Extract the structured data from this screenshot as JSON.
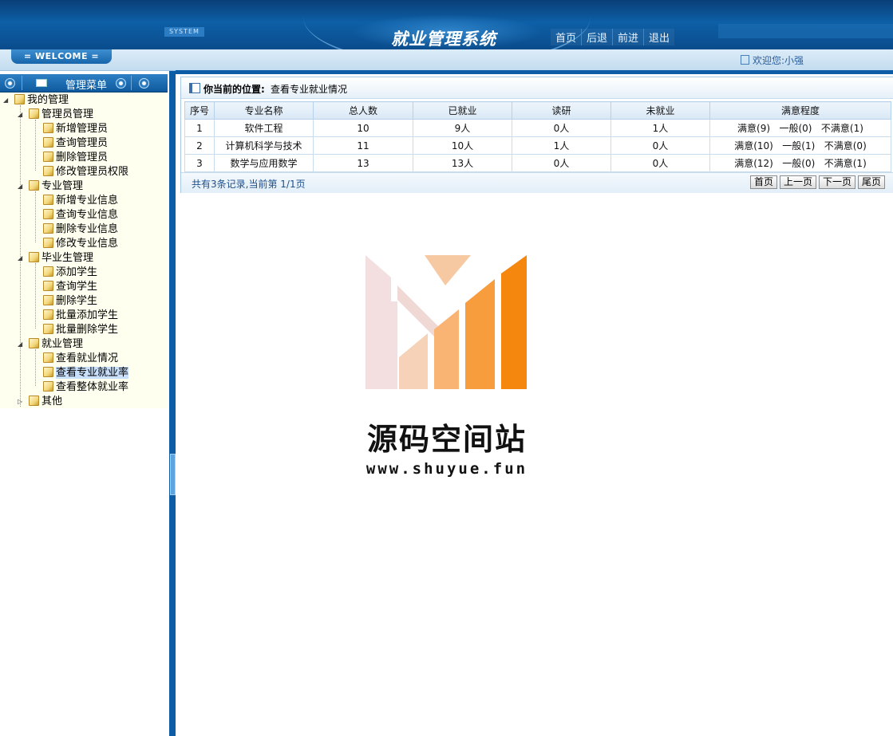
{
  "header": {
    "system_tag": "SYSTEM",
    "title": "就业管理系统",
    "nav": [
      "首页",
      "后退",
      "前进",
      "退出"
    ]
  },
  "welcome": {
    "badge": "= WELCOME =",
    "user_text": "欢迎您:小强"
  },
  "sidebar": {
    "menu_title": "管理菜单",
    "root": "我的管理",
    "groups": [
      {
        "label": "管理员管理",
        "items": [
          "新增管理员",
          "查询管理员",
          "删除管理员",
          "修改管理员权限"
        ]
      },
      {
        "label": "专业管理",
        "items": [
          "新增专业信息",
          "查询专业信息",
          "删除专业信息",
          "修改专业信息"
        ]
      },
      {
        "label": "毕业生管理",
        "items": [
          "添加学生",
          "查询学生",
          "删除学生",
          "批量添加学生",
          "批量删除学生"
        ]
      },
      {
        "label": "就业管理",
        "items": [
          "查看就业情况",
          "查看专业就业率",
          "查看整体就业率"
        ]
      },
      {
        "label": "其他",
        "items": []
      }
    ],
    "selected_item": "查看专业就业率"
  },
  "breadcrumb": {
    "label": "你当前的位置:",
    "value": "查看专业就业情况"
  },
  "table": {
    "columns": [
      "序号",
      "专业名称",
      "总人数",
      "已就业",
      "读研",
      "未就业",
      "满意程度"
    ],
    "rows": [
      [
        "1",
        "软件工程",
        "10",
        "9人",
        "0人",
        "1人",
        "满意(9)   一般(0)   不满意(1)"
      ],
      [
        "2",
        "计算机科学与技术",
        "11",
        "10人",
        "1人",
        "0人",
        "满意(10)   一般(1)   不满意(0)"
      ],
      [
        "3",
        "数学与应用数学",
        "13",
        "13人",
        "0人",
        "0人",
        "满意(12)   一般(0)   不满意(1)"
      ]
    ]
  },
  "pager": {
    "info": "共有3条记录,当前第 1/1页",
    "buttons": [
      "首页",
      "上一页",
      "下一页",
      "尾页"
    ]
  },
  "watermark": {
    "name": "源码空间站",
    "url": "www.shuyue.fun"
  },
  "colors": {
    "header_blue": "#0d5fa6",
    "tree_bg": "#fffff0",
    "logo_orange": "#f5870f"
  }
}
